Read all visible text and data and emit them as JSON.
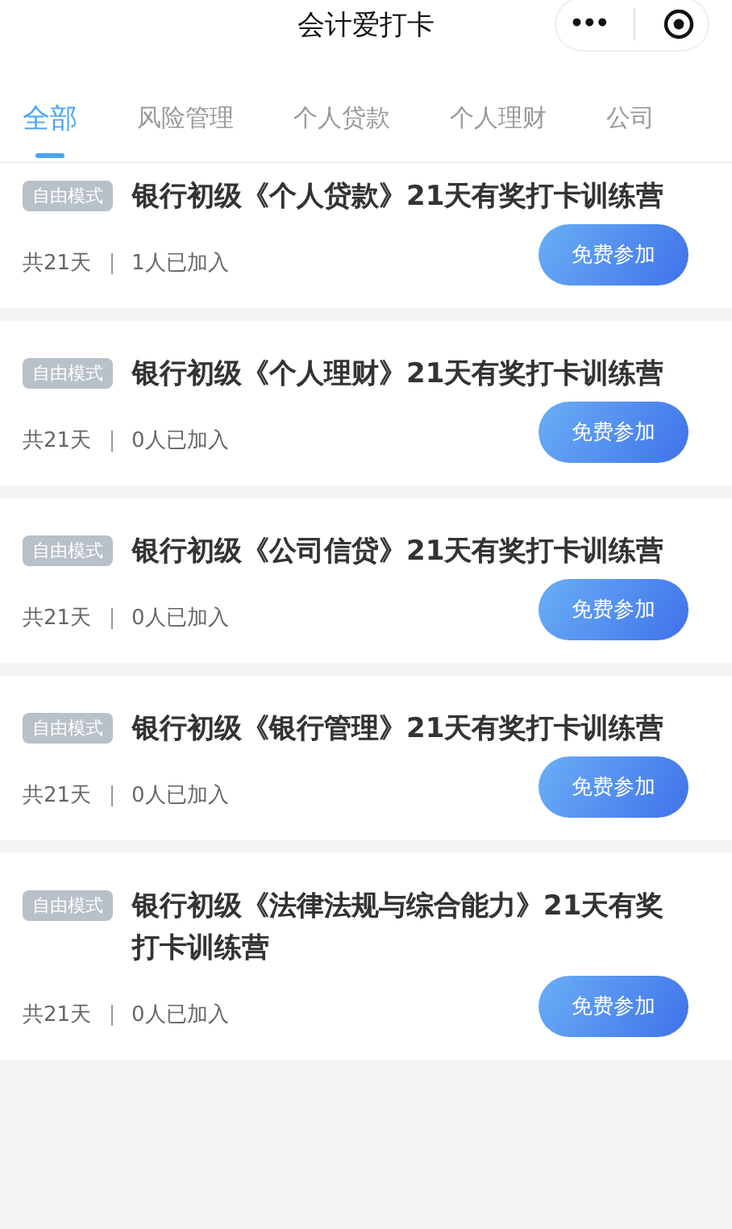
{
  "header": {
    "title": "会计爱打卡",
    "menu": "•••"
  },
  "tabs": [
    {
      "label": "全部",
      "selected": true
    },
    {
      "label": "风险管理",
      "selected": false
    },
    {
      "label": "个人贷款",
      "selected": false
    },
    {
      "label": "个人理财",
      "selected": false
    },
    {
      "label": "公司",
      "selected": false
    }
  ],
  "cards": [
    {
      "mode": "自由模式",
      "title": "银行初级《个人贷款》21天有奖打卡训练营",
      "days": "共21天",
      "joined": "1人已加入",
      "button": "免费参加"
    },
    {
      "mode": "自由模式",
      "title": "银行初级《个人理财》21天有奖打卡训练营",
      "days": "共21天",
      "joined": "0人已加入",
      "button": "免费参加"
    },
    {
      "mode": "自由模式",
      "title": "银行初级《公司信贷》21天有奖打卡训练营",
      "days": "共21天",
      "joined": "0人已加入",
      "button": "免费参加"
    },
    {
      "mode": "自由模式",
      "title": "银行初级《银行管理》21天有奖打卡训练营",
      "days": "共21天",
      "joined": "0人已加入",
      "button": "免费参加"
    },
    {
      "mode": "自由模式",
      "title": "银行初级《法律法规与综合能力》21天有奖打卡训练营",
      "days": "共21天",
      "joined": "0人已加入",
      "button": "免费参加"
    }
  ]
}
